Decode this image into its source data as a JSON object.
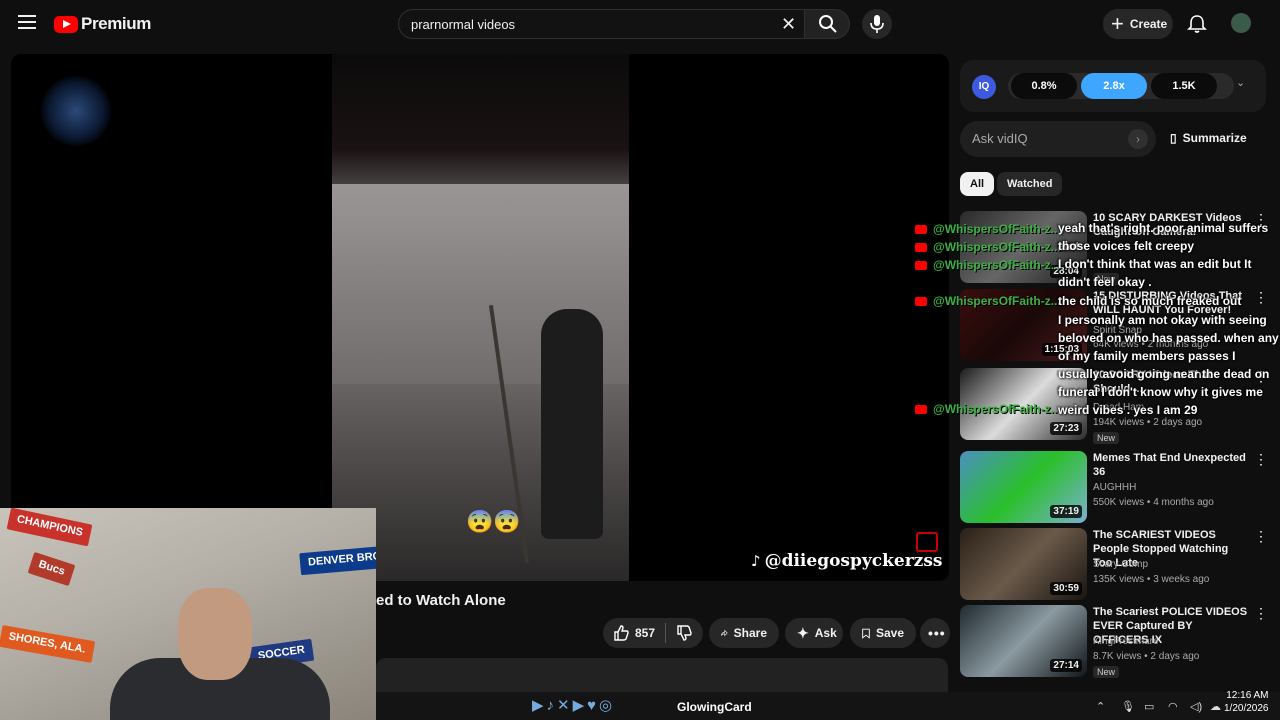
{
  "header": {
    "logo_text": "Premium",
    "search_value": "prarnormal videos",
    "create_label": "Create"
  },
  "player": {
    "emoji": "😨😨",
    "watermark": "@diiegospyckerzss",
    "title_partial": "ed to Watch Alone"
  },
  "actions": {
    "likes": "857",
    "share": "Share",
    "ask": "Ask",
    "save": "Save"
  },
  "vidiq": {
    "logo": "IQ",
    "stat1": "0.8%",
    "stat2": "2.8x",
    "stat3": "1.5K",
    "ask_placeholder": "Ask vidIQ",
    "summarize": "Summarize"
  },
  "filters": {
    "all": "All",
    "watched": "Watched"
  },
  "related": [
    {
      "title": "10 SCARY DARKEST Videos Caught On Camera!",
      "channel": "",
      "meta": "",
      "duration": "28:04",
      "new": "New"
    },
    {
      "title": "15 DISTURBING Videos That WILL HAUNT You Forever!",
      "channel": "Spirit Snap",
      "meta": "64K views • 2 months ago",
      "duration": "1:15:03",
      "new": ""
    },
    {
      "title": "10 SCARY Videos That Should ...",
      "channel": "Dread Ham",
      "meta": "194K views • 2 days ago",
      "duration": "27:23",
      "new": "New"
    },
    {
      "title": "Memes That End Unexpected 36",
      "channel": "AUGHHH",
      "meta": "550K views • 4 months ago",
      "duration": "37:19",
      "new": ""
    },
    {
      "title": "The SCARIEST VIDEOS People Stopped Watching Too Late",
      "channel": "Scary Comp",
      "meta": "135K views • 3 weeks ago",
      "duration": "30:59",
      "new": ""
    },
    {
      "title": "The Scariest POLICE VIDEOS EVER Captured BY OFFICERS IX",
      "channel": "KingFrostmare",
      "meta": "8.7K views • 2 days ago",
      "duration": "27:14",
      "new": "New"
    }
  ],
  "chat": {
    "user": "@WhispersOfFaith-z...",
    "messages": [
      "yeah that's right. poor animal suffers alot",
      "those voices felt creepy",
      "I don't think that was an edit but It didn't feel okay .",
      "the child is so much freaked out",
      "I personally am not okay with seeing beloved on who has passed. when any of my family members passes I usually avoid going near the dead on funeral I don't know why it gives me weird vibes . yes I am 29"
    ]
  },
  "stream_overlay": {
    "glowing_card": "GlowingCard"
  },
  "taskbar": {
    "time": "12:16 AM",
    "date": "1/20/2026"
  },
  "webcam_pennants": [
    "CHAMPIONS",
    "DENVER BRONCOS",
    "Bucs",
    "SHORES, ALA.",
    "SOCCER"
  ]
}
